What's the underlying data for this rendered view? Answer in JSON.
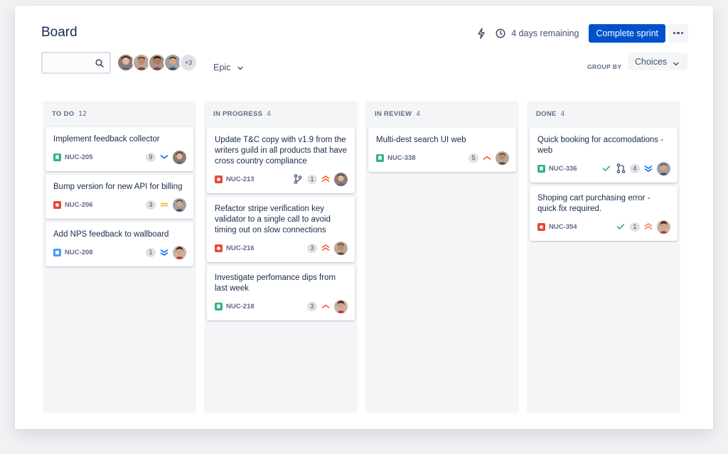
{
  "board": {
    "title": "Board",
    "remaining": "4 days remaining",
    "complete_label": "Complete sprint",
    "search_placeholder": "",
    "avatars_more": "+3",
    "epic_label": "Epic",
    "groupby_label": "GROUP BY",
    "groupby_value": "Choices"
  },
  "colors": {
    "primary": "#0052cc",
    "story": "#36b37e",
    "bug": "#e5493a",
    "task": "#4c9aff",
    "high": "#ff7452",
    "medium": "#ffab00",
    "low": "#0065ff",
    "done": "#36b37e"
  },
  "columns": [
    {
      "name": "TO DO",
      "count": "12"
    },
    {
      "name": "IN PROGRESS",
      "count": "4"
    },
    {
      "name": "IN REVIEW",
      "count": "4"
    },
    {
      "name": "DONE",
      "count": "4"
    }
  ],
  "cards": {
    "c205": {
      "title": "Implement feedback collector",
      "key": "NUC-205",
      "type": "story-icon",
      "points": "9",
      "priority": "low-priority-icon"
    },
    "c206": {
      "title": "Bump version for new API for billing",
      "key": "NUC-206",
      "type": "bug-icon",
      "points": "3",
      "priority": "medium-priority-icon"
    },
    "c208": {
      "title": "Add NPS feedback to wallboard",
      "key": "NUC-208",
      "type": "task-icon",
      "points": "1",
      "priority": "lowest-priority-icon"
    },
    "c213": {
      "title": "Update T&C copy with v1.9 from the writers guild in all products that have cross country compliance",
      "key": "NUC-213",
      "type": "bug-icon",
      "points": "1",
      "priority": "highest-priority-icon"
    },
    "c216": {
      "title": "Refactor stripe verification key validator to a single call to avoid timing out on slow connections",
      "key": "NUC-216",
      "type": "bug-icon",
      "points": "3",
      "priority": "highest-priority-icon"
    },
    "c218": {
      "title": "Investigate perfomance dips from last week",
      "key": "NUC-218",
      "type": "story-icon",
      "points": "3",
      "priority": "high-priority-icon"
    },
    "c338": {
      "title": "Multi-dest search UI web",
      "key": "NUC-338",
      "type": "story-icon",
      "points": "5",
      "priority": "high-priority-icon"
    },
    "c336": {
      "title": "Quick booking for accomodations - web",
      "key": "NUC-336",
      "type": "story-icon",
      "points": "4",
      "priority": "lowest-priority-icon"
    },
    "c354": {
      "title": "Shoping cart purchasing error - quick fix required.",
      "key": "NUC-354",
      "type": "bug-icon",
      "points": "1",
      "priority": "highest-priority-icon"
    }
  }
}
